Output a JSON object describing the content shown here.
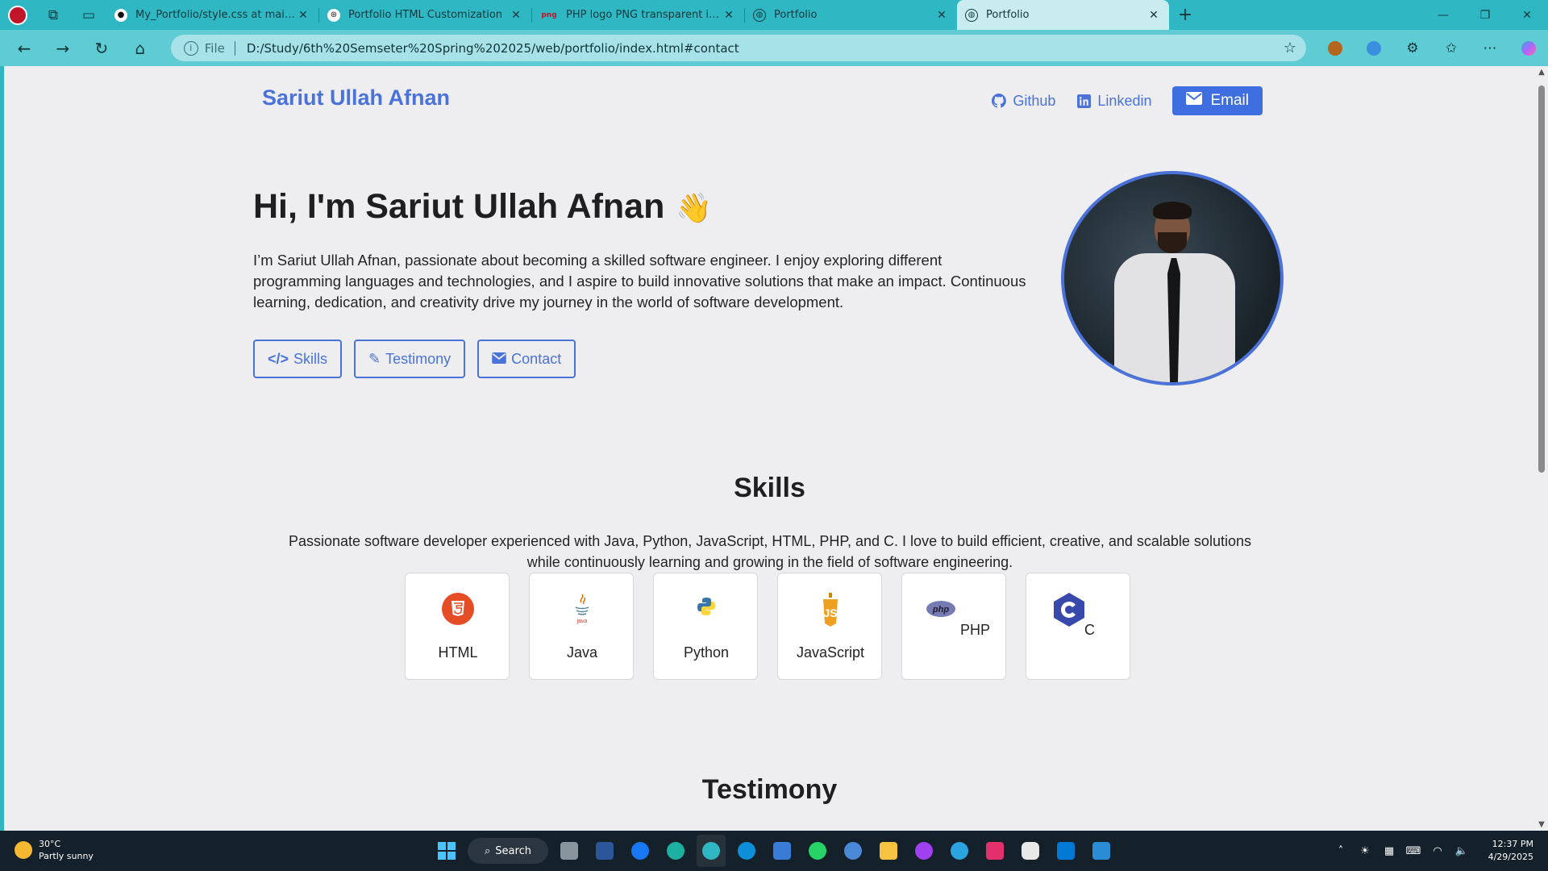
{
  "browser": {
    "tabs": [
      {
        "title": "My_Portfolio/style.css at main · Af",
        "favicon": "github-icon",
        "color": "#ffffff"
      },
      {
        "title": "Portfolio HTML Customization",
        "favicon": "chatgpt-icon",
        "color": "#ffffff"
      },
      {
        "title": "PHP logo PNG transparent image",
        "favicon": "png-icon",
        "color": "#c0152a"
      },
      {
        "title": "Portfolio",
        "favicon": "globe-icon",
        "color": "#ffffff"
      },
      {
        "title": "Portfolio",
        "favicon": "globe-icon",
        "color": "#ffffff",
        "active": true
      }
    ],
    "address": {
      "scheme": "File",
      "url": "D:/Study/6th%20Semseter%20Spring%202025/web/portfolio/index.html#contact"
    }
  },
  "site": {
    "brand": "Sariut Ullah Afnan",
    "nav": {
      "github": "Github",
      "linkedin": "Linkedin",
      "email": "Email"
    },
    "hero": {
      "title": "Hi, I'm Sariut Ullah Afnan",
      "wave": "👋",
      "text": "I’m Sariut Ullah Afnan, passionate about becoming a skilled software engineer. I enjoy exploring different programming languages and technologies, and I aspire to build innovative solutions that make an impact. Continuous learning, dedication, and creativity drive my journey in the world of software development.",
      "buttons": {
        "skills": "Skills",
        "testimony": "Testimony",
        "contact": "Contact"
      }
    },
    "skills": {
      "title": "Skills",
      "text": "Passionate software developer experienced with Java, Python, JavaScript, HTML, PHP, and C. I love to build efficient, creative, and scalable solutions while continuously learning and growing in the field of software engineering.",
      "items": [
        {
          "label": "HTML",
          "icon": "html5-icon",
          "color": "#e44d26"
        },
        {
          "label": "Java",
          "icon": "java-icon",
          "color": "#e76f00"
        },
        {
          "label": "Python",
          "icon": "python-icon",
          "color": "#3776ab"
        },
        {
          "label": "JavaScript",
          "icon": "javascript-icon",
          "color": "#f0a020"
        },
        {
          "label": "PHP",
          "icon": "php-icon",
          "color": "#777bb4"
        },
        {
          "label": "C",
          "icon": "c-icon",
          "color": "#3949ab"
        }
      ]
    },
    "testimony": {
      "title": "Testimony"
    }
  },
  "taskbar": {
    "weather": {
      "temp": "30°C",
      "desc": "Partly sunny"
    },
    "search_label": "Search",
    "time": "12:37 PM",
    "date": "4/29/2025"
  },
  "colors": {
    "accent": "#4a72d8",
    "email_button": "#3f6ee0",
    "browser_frame": "#2fb8c3"
  }
}
